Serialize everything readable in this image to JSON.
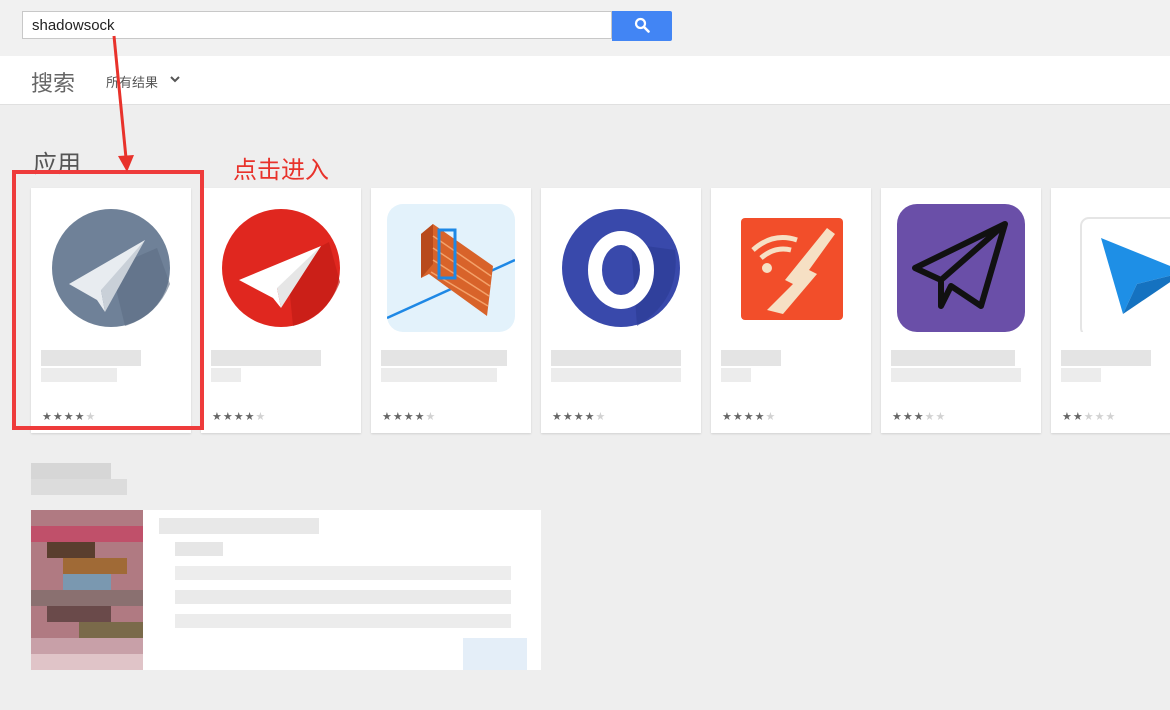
{
  "search": {
    "query": "shadowsock"
  },
  "subnav": {
    "title": "搜索",
    "filter_label": "所有结果"
  },
  "apps_section": {
    "title": "应用"
  },
  "annotation": {
    "text": "点击进入",
    "color": "#e8322b"
  },
  "apps": [
    {
      "icon": "paper-plane-gray-circle-icon",
      "rating": 4.5
    },
    {
      "icon": "paper-plane-red-circle-icon",
      "rating": 4
    },
    {
      "icon": "firewall-bricks-icon",
      "rating": 4
    },
    {
      "icon": "letter-o-blue-circle-icon",
      "rating": 4.5
    },
    {
      "icon": "wifi-lightning-orange-icon",
      "rating": 4
    },
    {
      "icon": "paper-plane-purple-icon",
      "rating": 3.5
    },
    {
      "icon": "paper-plane-blue-white-icon",
      "rating": 2.5
    }
  ],
  "colors": {
    "search_button": "#4285f4",
    "highlight_box": "#ee3b3b"
  }
}
